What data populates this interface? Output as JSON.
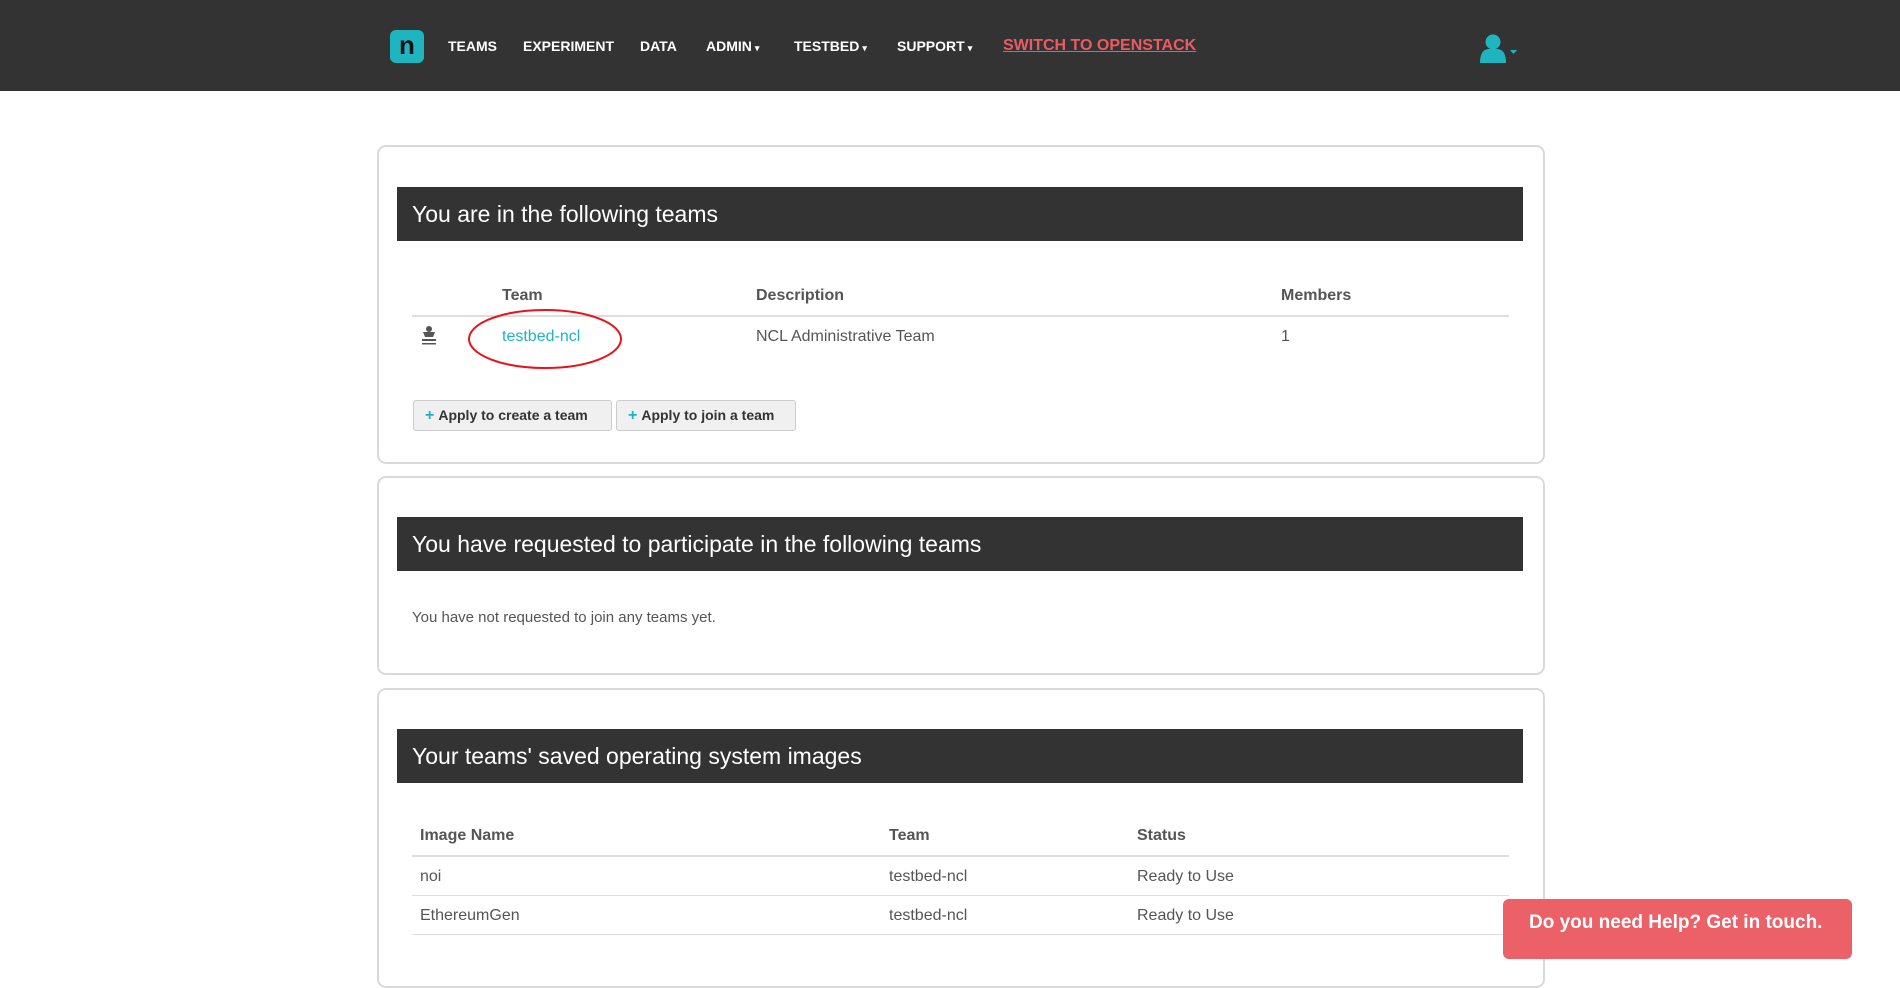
{
  "nav": {
    "logo": "n",
    "items": [
      "TEAMS",
      "EXPERIMENT",
      "DATA",
      "ADMIN",
      "TESTBED",
      "SUPPORT"
    ],
    "caret": "▾",
    "switch": "SWITCH TO OPENSTACK"
  },
  "teams": {
    "title": "You are in the following teams",
    "headers": [
      "Team",
      "Description",
      "Members"
    ],
    "rows": [
      {
        "team": "testbed-ncl",
        "description": "NCL Administrative Team",
        "members": "1"
      }
    ],
    "create": "Apply to create a team",
    "join": "Apply to join a team",
    "plus": "+"
  },
  "requests": {
    "title": "You have requested to participate in the following teams",
    "empty": "You have not requested to join any teams yet."
  },
  "images": {
    "title": "Your teams' saved operating system images",
    "headers": [
      "Image Name",
      "Team",
      "Status"
    ],
    "rows": [
      {
        "name": "noi",
        "team": "testbed-ncl",
        "status": "Ready to Use"
      },
      {
        "name": "EthereumGen",
        "team": "testbed-ncl",
        "status": "Ready to Use"
      }
    ]
  },
  "help": "Do you need Help? Get in touch."
}
